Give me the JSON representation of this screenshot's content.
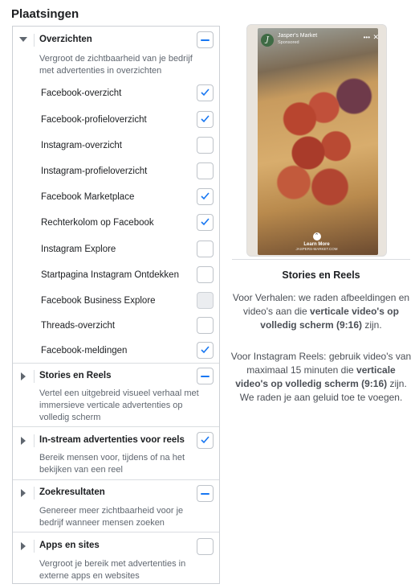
{
  "section_title": "Plaatsingen",
  "groups": {
    "overzichten": {
      "title": "Overzichten",
      "desc": "Vergroot de zichtbaarheid van je bedrijf met advertenties in overzichten",
      "state": "partial",
      "items": [
        {
          "label": "Facebook-overzicht",
          "checked": true
        },
        {
          "label": "Facebook-profieloverzicht",
          "checked": true
        },
        {
          "label": "Instagram-overzicht",
          "checked": false
        },
        {
          "label": "Instagram-profieloverzicht",
          "checked": false
        },
        {
          "label": "Facebook Marketplace",
          "checked": true
        },
        {
          "label": "Rechterkolom op Facebook",
          "checked": true
        },
        {
          "label": "Instagram Explore",
          "checked": false
        },
        {
          "label": "Startpagina Instagram Ontdekken",
          "checked": false
        },
        {
          "label": "Facebook Business Explore",
          "checked": false,
          "disabled": true
        },
        {
          "label": "Threads-overzicht",
          "checked": false
        },
        {
          "label": "Facebook-meldingen",
          "checked": true
        }
      ]
    },
    "stories": {
      "title": "Stories en Reels",
      "desc": "Vertel een uitgebreid visueel verhaal met immersieve verticale advertenties op volledig scherm",
      "state": "partial"
    },
    "instream": {
      "title": "In-stream advertenties voor reels",
      "desc": "Bereik mensen voor, tijdens of na het bekijken van een reel",
      "state": "checked"
    },
    "zoek": {
      "title": "Zoekresultaten",
      "desc": "Genereer meer zichtbaarheid voor je bedrijf wanneer mensen zoeken",
      "state": "partial"
    },
    "apps": {
      "title": "Apps en sites",
      "desc": "Vergroot je bereik met advertenties in externe apps en websites",
      "state": "unchecked"
    }
  },
  "preview": {
    "logo_letter": "J",
    "brand": "Jasper's Market",
    "sponsored": "Sponsored",
    "dots": "•••",
    "close": "✕",
    "learn_more": "Learn More",
    "url": "JASPERS-MARKET.COM",
    "title": "Stories en Reels",
    "p1_pre": "Voor Verhalen: we raden afbeeldingen en video's aan die ",
    "p1_bold": "verticale video's op volledig scherm (9:16)",
    "p1_post": " zijn.",
    "p2_pre": "Voor Instagram Reels: gebruik video's van maximaal 15 minuten die ",
    "p2_bold": "verticale video's op volledig scherm (9:16)",
    "p2_post": " zijn. We raden je aan geluid toe te voegen."
  },
  "colors": {
    "accent": "#1877f2",
    "border": "#ccd0d5"
  }
}
